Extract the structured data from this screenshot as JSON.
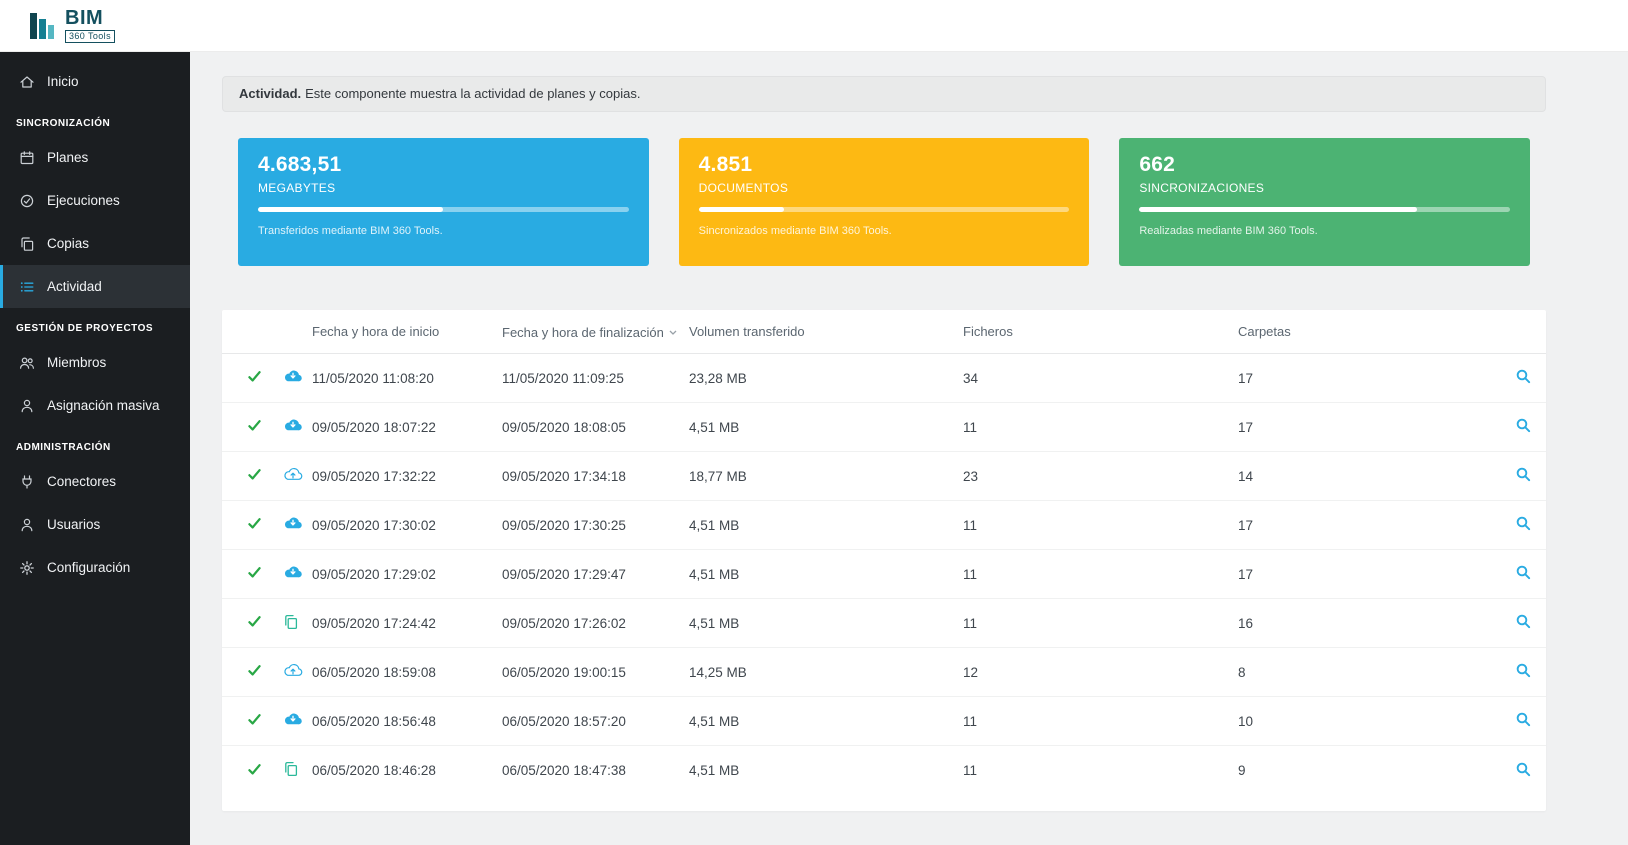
{
  "colors": {
    "accent": "#29abe2",
    "success": "#28a745",
    "copy-accent": "#2bb99a",
    "sidebar-bg": "#1b1e21",
    "sidebar-active-bg": "#2c3136",
    "main-bg": "#f0f1f2"
  },
  "brand": {
    "title": "BIM",
    "subtitle": "360 Tools"
  },
  "sidebar": {
    "items": [
      {
        "type": "item",
        "icon": "home-icon",
        "label": "Inicio",
        "active": false
      },
      {
        "type": "section",
        "label": "SINCRONIZACIÓN"
      },
      {
        "type": "item",
        "icon": "calendar-icon",
        "label": "Planes",
        "active": false
      },
      {
        "type": "item",
        "icon": "check-circle-icon",
        "label": "Ejecuciones",
        "active": false
      },
      {
        "type": "item",
        "icon": "copy-icon",
        "label": "Copias",
        "active": false
      },
      {
        "type": "item",
        "icon": "list-icon",
        "label": "Actividad",
        "active": true
      },
      {
        "type": "section",
        "label": "GESTIÓN DE PROYECTOS"
      },
      {
        "type": "item",
        "icon": "users-icon",
        "label": "Miembros",
        "active": false
      },
      {
        "type": "item",
        "icon": "user-icon",
        "label": "Asignación masiva",
        "active": false
      },
      {
        "type": "section",
        "label": "ADMINISTRACIÓN"
      },
      {
        "type": "item",
        "icon": "plug-icon",
        "label": "Conectores",
        "active": false
      },
      {
        "type": "item",
        "icon": "user-icon",
        "label": "Usuarios",
        "active": false
      },
      {
        "type": "item",
        "icon": "gear-icon",
        "label": "Configuración",
        "active": false
      }
    ]
  },
  "alert": {
    "title": "Actividad.",
    "body": "Este componente muestra la actividad de planes y copias."
  },
  "stat_cards": [
    {
      "value": "4.683,51",
      "label": "MEGABYTES",
      "caption": "Transferidos mediante BIM 360 Tools.",
      "color": "#29abe2",
      "progress_percent": 50
    },
    {
      "value": "4.851",
      "label": "DOCUMENTOS",
      "caption": "Sincronizados mediante BIM 360 Tools.",
      "color": "#fdb913",
      "progress_percent": 23
    },
    {
      "value": "662",
      "label": "SINCRONIZACIONES",
      "caption": "Realizadas mediante BIM 360 Tools.",
      "color": "#4cb373",
      "progress_percent": 75
    }
  ],
  "table": {
    "headers": [
      "Fecha y hora de inicio",
      "Fecha y hora de finalización",
      "Volumen transferido",
      "Ficheros",
      "Carpetas"
    ],
    "sorted_by": "Fecha y hora de finalización",
    "rows": [
      {
        "status": "success",
        "type": "cloud-download",
        "start": "11/05/2020 11:08:20",
        "end": "11/05/2020 11:09:25",
        "volume": "23,28 MB",
        "files": "34",
        "folders": "17"
      },
      {
        "status": "success",
        "type": "cloud-download",
        "start": "09/05/2020 18:07:22",
        "end": "09/05/2020 18:08:05",
        "volume": "4,51 MB",
        "files": "11",
        "folders": "17"
      },
      {
        "status": "success",
        "type": "cloud-upload",
        "start": "09/05/2020 17:32:22",
        "end": "09/05/2020 17:34:18",
        "volume": "18,77 MB",
        "files": "23",
        "folders": "14"
      },
      {
        "status": "success",
        "type": "cloud-download",
        "start": "09/05/2020 17:30:02",
        "end": "09/05/2020 17:30:25",
        "volume": "4,51 MB",
        "files": "11",
        "folders": "17"
      },
      {
        "status": "success",
        "type": "cloud-download",
        "start": "09/05/2020 17:29:02",
        "end": "09/05/2020 17:29:47",
        "volume": "4,51 MB",
        "files": "11",
        "folders": "17"
      },
      {
        "status": "success",
        "type": "copy",
        "start": "09/05/2020 17:24:42",
        "end": "09/05/2020 17:26:02",
        "volume": "4,51 MB",
        "files": "11",
        "folders": "16"
      },
      {
        "status": "success",
        "type": "cloud-upload",
        "start": "06/05/2020 18:59:08",
        "end": "06/05/2020 19:00:15",
        "volume": "14,25 MB",
        "files": "12",
        "folders": "8"
      },
      {
        "status": "success",
        "type": "cloud-download",
        "start": "06/05/2020 18:56:48",
        "end": "06/05/2020 18:57:20",
        "volume": "4,51 MB",
        "files": "11",
        "folders": "10"
      },
      {
        "status": "success",
        "type": "copy",
        "start": "06/05/2020 18:46:28",
        "end": "06/05/2020 18:47:38",
        "volume": "4,51 MB",
        "files": "11",
        "folders": "9"
      }
    ]
  }
}
